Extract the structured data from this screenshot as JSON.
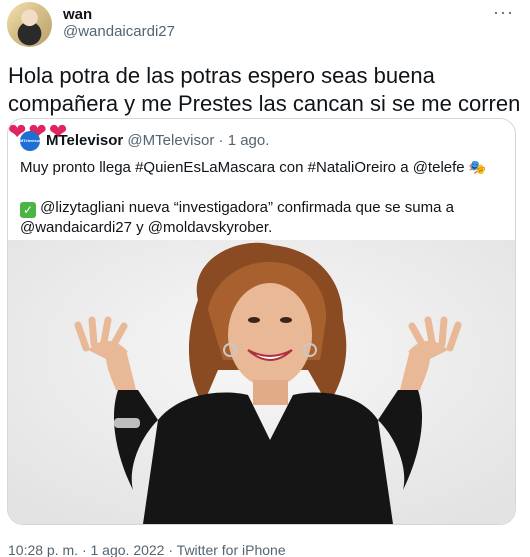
{
  "author": {
    "display_name": "wan",
    "handle": "@wandaicardi27",
    "more_label": "···"
  },
  "tweet": {
    "text": "Hola potra de las potras espero seas buena compañera y me Prestes las cancan si se me corren",
    "emoji": "❤❤❤"
  },
  "quote": {
    "avatar_label": "MTelevisor",
    "name": "MTelevisor",
    "handle": "@MTelevisor",
    "separator": "·",
    "date": "1 ago.",
    "line1": "Muy pronto llega #QuienEsLaMascara con #NataliOreiro a @telefe",
    "line1_emoji": "🎭",
    "check_emoji": "✓",
    "line2": "@lizytagliani nueva “investigadora” confirmada que se suma a @wandaicardi27 y @moldavskyrober."
  },
  "footer": {
    "time": "10:28 p. m.",
    "separator1": "·",
    "date": "1 ago. 2022",
    "separator2": "·",
    "source": "Twitter for iPhone"
  },
  "colors": {
    "text": "#0f1419",
    "secondary": "#536471",
    "border": "#cfd9de",
    "heart": "#e0245e",
    "check": "#4bb543"
  }
}
